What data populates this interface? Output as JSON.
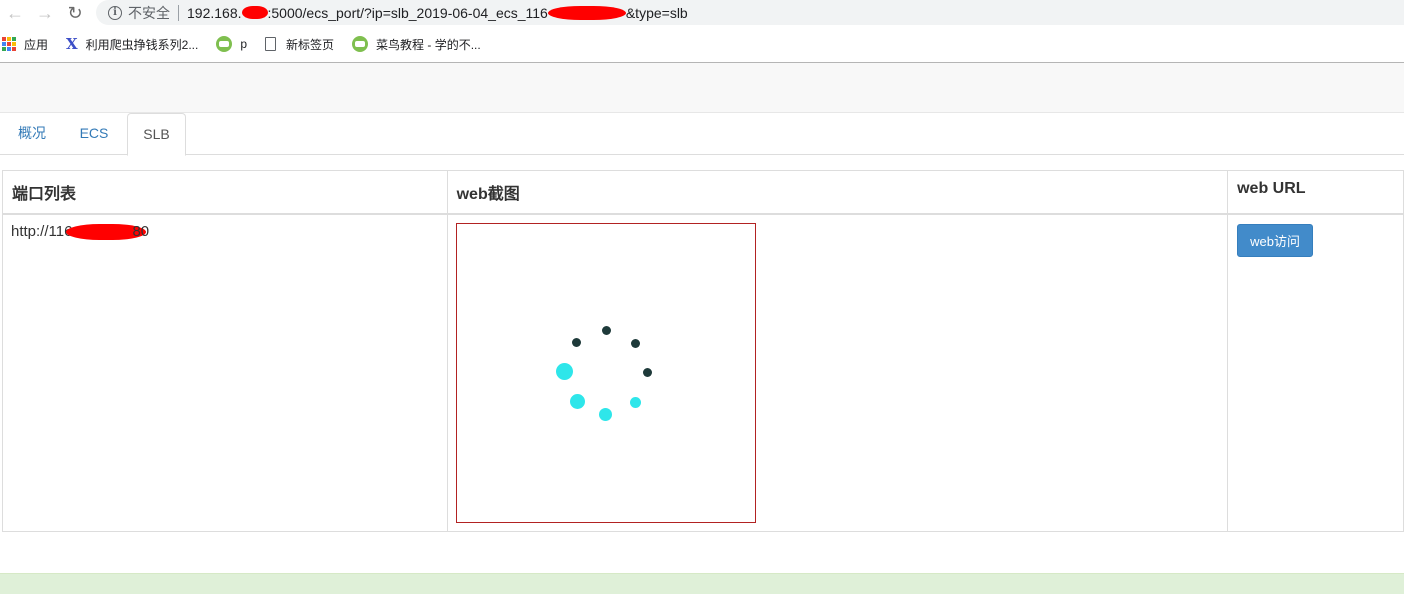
{
  "browser": {
    "back_icon": "arrow-left-icon",
    "forward_icon": "arrow-right-icon",
    "reload_icon": "reload-icon",
    "security_label": "不安全",
    "url_part1": "192.168.",
    "url_part2": ":5000/ecs_port/?ip=slb_2019-06-04_ecs_116",
    "url_part3": "&type=slb"
  },
  "bookmarks": [
    {
      "label": "应用",
      "icon": "apps-grid-icon"
    },
    {
      "label": "利用爬虫挣钱系列2...",
      "icon": "x-logo-icon"
    },
    {
      "label": "p",
      "icon": "kb-icon"
    },
    {
      "label": "新标签页",
      "icon": "page-icon"
    },
    {
      "label": "菜鸟教程 - 学的不...",
      "icon": "runoob-icon"
    }
  ],
  "tabs": [
    {
      "label": "概况",
      "active": false
    },
    {
      "label": "ECS",
      "active": false
    },
    {
      "label": "SLB",
      "active": true
    }
  ],
  "table": {
    "headers": [
      "端口列表",
      "web截图",
      "web URL"
    ],
    "rows": [
      {
        "port_prefix": "http://116",
        "port_suffix": "80",
        "screenshot": "loading-spinner",
        "button_label": "web访问"
      }
    ]
  },
  "colors": {
    "link": "#337ab7",
    "button": "#428bca",
    "spinner_dark": "#1e3a3a",
    "spinner_cyan": "#2ee6ea",
    "screenshot_border": "#b22222",
    "redaction": "#ff0000"
  }
}
